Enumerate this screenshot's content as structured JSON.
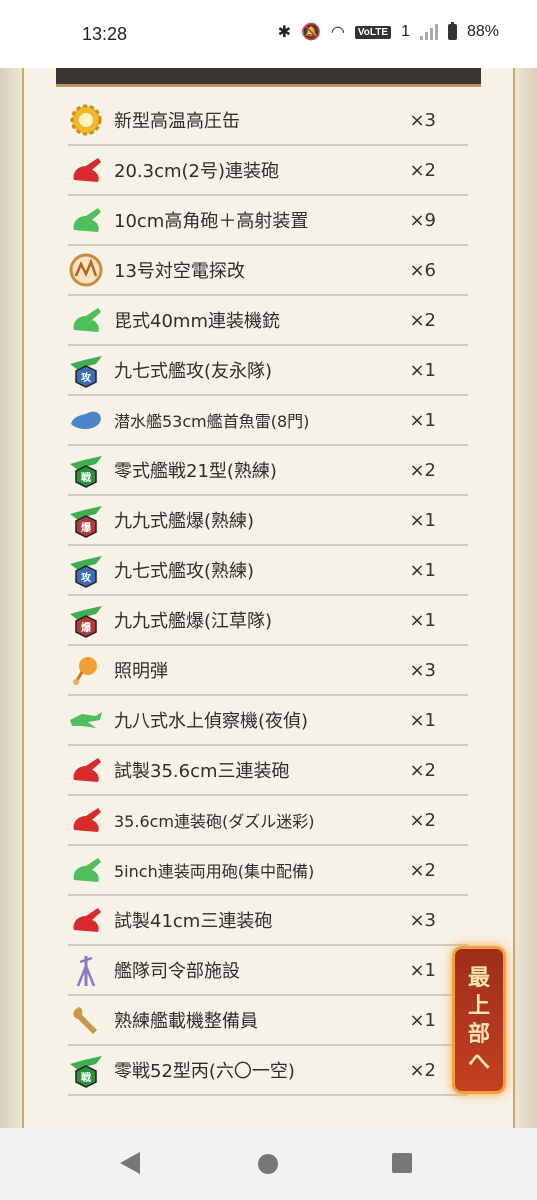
{
  "status": {
    "time": "13:28",
    "battery": "88%",
    "volte": "VoLTE",
    "volte_sub": "1"
  },
  "items": [
    {
      "name": "新型高温高圧缶",
      "qty": "×3",
      "icon": "boiler-icon",
      "color": "#f0b830"
    },
    {
      "name": "20.3cm(2号)連装砲",
      "qty": "×2",
      "icon": "medium-gun-icon",
      "color": "#d92b2b"
    },
    {
      "name": "10cm高角砲＋高射装置",
      "qty": "×9",
      "icon": "high-angle-gun-icon",
      "color": "#4fbf5a"
    },
    {
      "name": "13号対空電探改",
      "qty": "×6",
      "icon": "radar-icon",
      "color": "#c98b3e"
    },
    {
      "name": "毘式40mm連装機銃",
      "qty": "×2",
      "icon": "aa-gun-icon",
      "color": "#4fbf5a"
    },
    {
      "name": "九七式艦攻(友永隊)",
      "qty": "×1",
      "icon": "torpedo-bomber-icon",
      "color": "#3a6db5",
      "badge": "攻"
    },
    {
      "name": "潜水艦53cm艦首魚雷(8門)",
      "qty": "×1",
      "icon": "torpedo-icon",
      "color": "#4d86c6"
    },
    {
      "name": "零式艦戦21型(熟練)",
      "qty": "×2",
      "icon": "fighter-icon",
      "color": "#2f8f3a",
      "badge": "戦"
    },
    {
      "name": "九九式艦爆(熟練)",
      "qty": "×1",
      "icon": "dive-bomber-icon",
      "color": "#b23a3a",
      "badge": "爆"
    },
    {
      "name": "九七式艦攻(熟練)",
      "qty": "×1",
      "icon": "torpedo-bomber-icon",
      "color": "#3a6db5",
      "badge": "攻"
    },
    {
      "name": "九九式艦爆(江草隊)",
      "qty": "×1",
      "icon": "dive-bomber-icon",
      "color": "#b23a3a",
      "badge": "爆"
    },
    {
      "name": "照明弾",
      "qty": "×3",
      "icon": "star-shell-icon",
      "color": "#f0a030"
    },
    {
      "name": "九八式水上偵察機(夜偵)",
      "qty": "×1",
      "icon": "seaplane-icon",
      "color": "#4fbf5a"
    },
    {
      "name": "試製35.6cm三連装砲",
      "qty": "×2",
      "icon": "large-gun-icon",
      "color": "#d92b2b"
    },
    {
      "name": "35.6cm連装砲(ダズル迷彩)",
      "qty": "×2",
      "icon": "large-gun-icon",
      "color": "#d92b2b"
    },
    {
      "name": "5inch連装両用砲(集中配備)",
      "qty": "×2",
      "icon": "high-angle-gun-icon",
      "color": "#4fbf5a"
    },
    {
      "name": "試製41cm三連装砲",
      "qty": "×3",
      "icon": "large-gun-icon",
      "color": "#d92b2b"
    },
    {
      "name": "艦隊司令部施設",
      "qty": "×1",
      "icon": "command-facility-icon",
      "color": "#8a7bc0"
    },
    {
      "name": "熟練艦載機整備員",
      "qty": "×1",
      "icon": "wrench-icon",
      "color": "#c8964a"
    },
    {
      "name": "零戦52型丙(六〇一空)",
      "qty": "×2",
      "icon": "fighter-icon",
      "color": "#2f8f3a",
      "badge": "戦"
    }
  ],
  "scroll_top": {
    "label": [
      "最",
      "上",
      "部",
      "へ"
    ]
  }
}
